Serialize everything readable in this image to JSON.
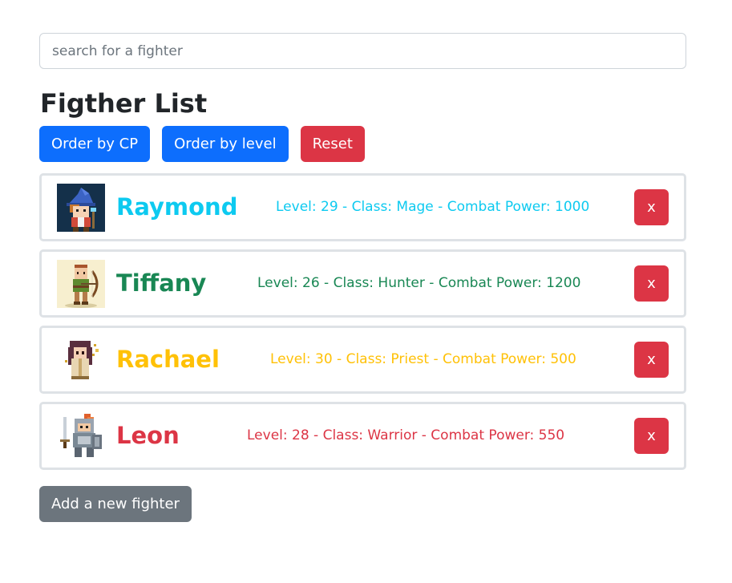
{
  "search": {
    "placeholder": "search for a fighter",
    "value": ""
  },
  "title": "Figther List",
  "buttons": {
    "order_cp": "Order by CP",
    "order_level": "Order by level",
    "reset": "Reset",
    "add": "Add a new fighter"
  },
  "fighters": [
    {
      "name": "Raymond",
      "stats": "Level: 29 - Class: Mage - Combat Power: 1000",
      "color": "#0dcaf0",
      "delete_label": "x"
    },
    {
      "name": "Tiffany",
      "stats": "Level: 26 - Class: Hunter - Combat Power: 1200",
      "color": "#198754",
      "delete_label": "x"
    },
    {
      "name": "Rachael",
      "stats": "Level: 30 - Class: Priest - Combat Power: 500",
      "color": "#ffc107",
      "delete_label": "x"
    },
    {
      "name": "Leon",
      "stats": "Level: 28 - Class: Warrior - Combat Power: 550",
      "color": "#dc3545",
      "delete_label": "x"
    }
  ],
  "colors": {
    "primary": "#0d6efd",
    "danger": "#dc3545",
    "secondary": "#6c757d",
    "border": "#dee2e6"
  }
}
